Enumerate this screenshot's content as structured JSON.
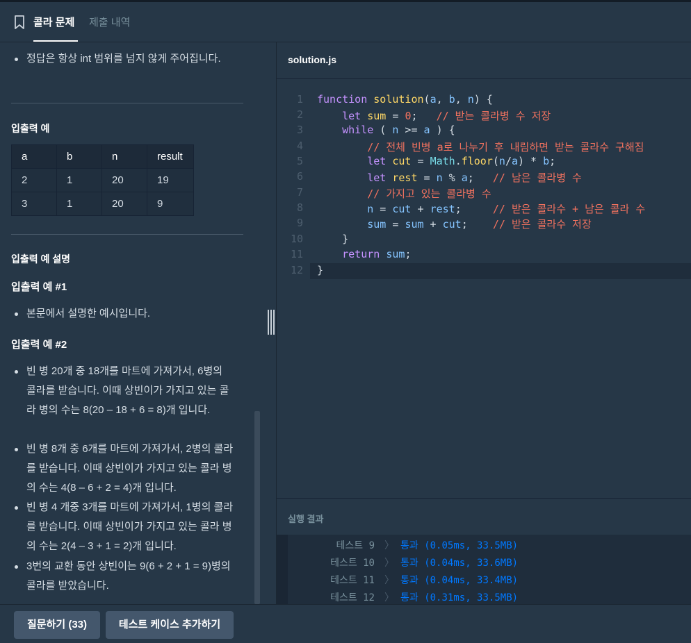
{
  "header": {
    "tab_active": "콜라 문제",
    "tab_inactive": "제출 내역"
  },
  "description": {
    "bullet_note": "정답은 항상 int 범위를 넘지 않게 주어집니다.",
    "io_title": "입출력 예",
    "table": {
      "headers": [
        "a",
        "b",
        "n",
        "result"
      ],
      "rows": [
        [
          "2",
          "1",
          "20",
          "19"
        ],
        [
          "3",
          "1",
          "20",
          "9"
        ]
      ]
    },
    "explain_title": "입출력 예 설명",
    "ex1_title": "입출력 예 #1",
    "ex1_items": [
      "본문에서 설명한 예시입니다."
    ],
    "ex2_title": "입출력 예 #2",
    "ex2_items": [
      "빈 병 20개 중 18개를 마트에 가져가서, 6병의 콜라를 받습니다. 이때 상빈이가 가지고 있는 콜라 병의 수는 8(20 – 18 + 6 = 8)개 입니다.",
      "빈 병 8개 중 6개를 마트에 가져가서, 2병의 콜라를 받습니다. 이때 상빈이가 가지고 있는 콜라 병의 수는 4(8 – 6 + 2 = 4)개 입니다.",
      "빈 병 4 개중 3개를 마트에 가져가서, 1병의 콜라를 받습니다. 이때 상빈이가 가지고 있는 콜라 병의 수는 2(4 – 3 + 1 = 2)개 입니다.",
      "3번의 교환 동안 상빈이는 9(6 + 2 + 1 = 9)병의 콜라를 받았습니다."
    ]
  },
  "editor": {
    "filename": "solution.js",
    "line_numbers": [
      "1",
      "2",
      "3",
      "4",
      "5",
      "6",
      "7",
      "8",
      "9",
      "10",
      "11",
      "12"
    ]
  },
  "result": {
    "title": "실행 결과",
    "tests": [
      {
        "name": "테스트 9",
        "chevron": "〉",
        "status": "통과 (0.05ms, 33.5MB)"
      },
      {
        "name": "테스트 10",
        "chevron": "〉",
        "status": "통과 (0.04ms, 33.6MB)"
      },
      {
        "name": "테스트 11",
        "chevron": "〉",
        "status": "통과 (0.04ms, 33.4MB)"
      },
      {
        "name": "테스트 12",
        "chevron": "〉",
        "status": "통과 (0.31ms, 33.5MB)"
      }
    ]
  },
  "footer": {
    "ask_button": "질문하기 (33)",
    "add_testcase_button": "테스트 케이스 추가하기"
  },
  "colors": {
    "background": "#263747",
    "pass": "#0078ff",
    "button": "#44576c"
  }
}
